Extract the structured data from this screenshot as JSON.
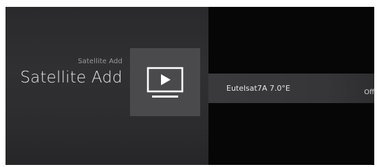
{
  "header": {
    "breadcrumb": "Satellite Add",
    "title": "Satellite Add",
    "icon": "tv-play-icon"
  },
  "list": {
    "rows": [
      {
        "label": "Eutelsat7A 7.0°E",
        "value": "Off"
      }
    ]
  },
  "colors": {
    "panel_bg": "#2e2e30",
    "tile_bg": "#4a4a4c",
    "row_bg": "#38383a",
    "background": "#050505"
  }
}
